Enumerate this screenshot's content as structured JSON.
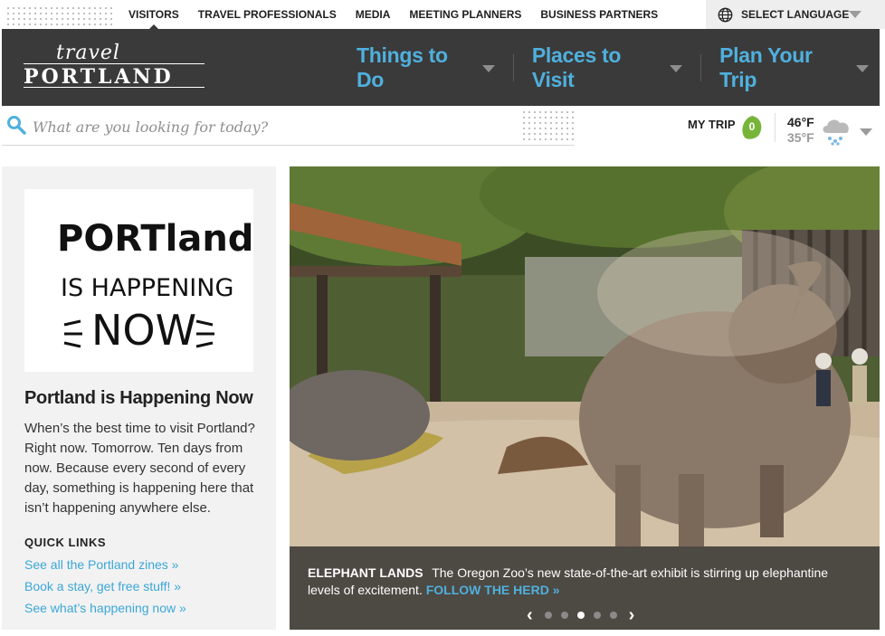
{
  "audience_nav": {
    "items": [
      {
        "label": "VISITORS",
        "active": true
      },
      {
        "label": "TRAVEL PROFESSIONALS",
        "active": false
      },
      {
        "label": "MEDIA",
        "active": false
      },
      {
        "label": "MEETING PLANNERS",
        "active": false
      },
      {
        "label": "BUSINESS PARTNERS",
        "active": false
      }
    ],
    "language_label": "SELECT LANGUAGE"
  },
  "header": {
    "logo_script": "travel",
    "logo_word": "PORTLAND",
    "nav": [
      {
        "label": "Things to Do"
      },
      {
        "label": "Places to Visit"
      },
      {
        "label": "Plan Your Trip"
      }
    ],
    "accent_color": "#4fb0dd",
    "background_color": "#3a3a3a"
  },
  "search": {
    "placeholder": "What are you looking for today?",
    "value": ""
  },
  "my_trip": {
    "label": "MY TRIP",
    "count": "0"
  },
  "weather": {
    "high": "46°F",
    "low": "35°F",
    "icon": "rain-cloud-icon"
  },
  "left_panel": {
    "promo_image_text": [
      "PORTland",
      "IS HAPPENING",
      "NOW"
    ],
    "title": "Portland is Happening Now",
    "body": "When’s the best time to visit Portland? Right now. Tomorrow. Ten days from now. Because every second of every day, something is happening here that isn’t happening anywhere else.",
    "quick_links_heading": "QUICK LINKS",
    "quick_links": [
      "See all the Portland zines »",
      "Book a stay, get free stuff! »",
      "See what’s happening now »"
    ]
  },
  "hero": {
    "caption_title": "ELEPHANT LANDS",
    "caption_text": "The Oregon Zoo’s new state-of-the-art exhibit is stirring up elephantine levels of excitement.",
    "caption_link": "FOLLOW THE HERD »",
    "slides_total": 5,
    "slide_active": 3,
    "prev_label": "‹",
    "next_label": "›"
  }
}
